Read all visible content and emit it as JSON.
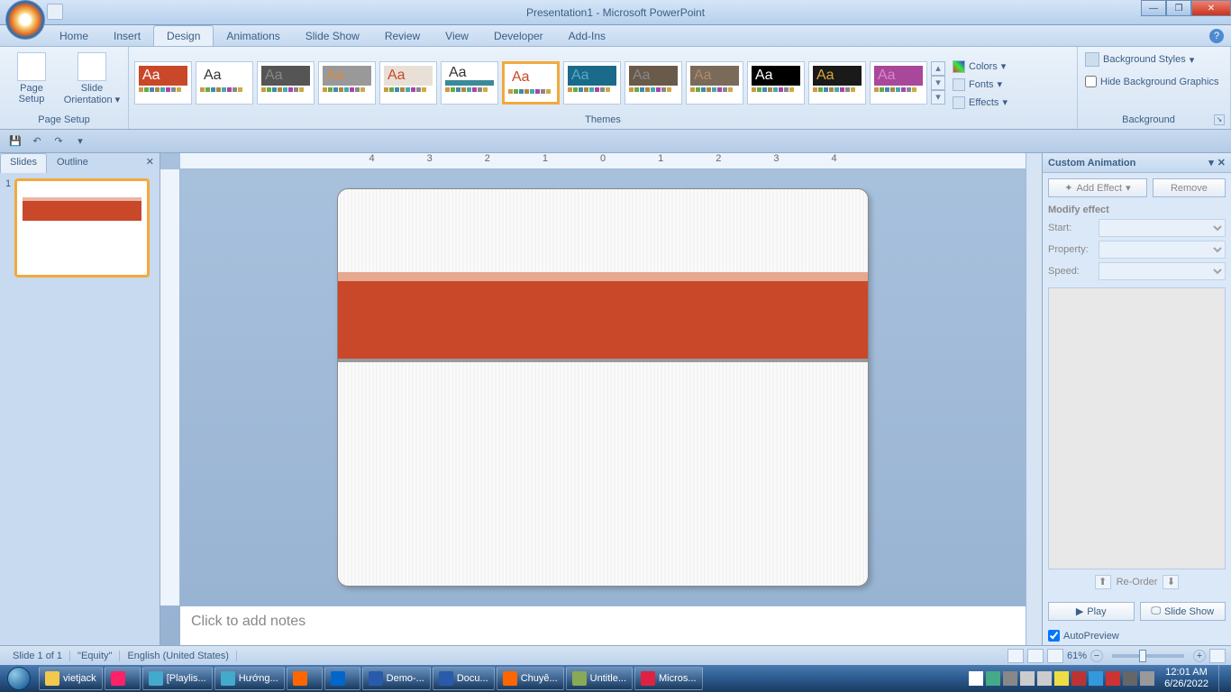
{
  "title": "Presentation1 - Microsoft PowerPoint",
  "tabs": [
    "Home",
    "Insert",
    "Design",
    "Animations",
    "Slide Show",
    "Review",
    "View",
    "Developer",
    "Add-Ins"
  ],
  "active_tab": "Design",
  "ribbon": {
    "page_setup": {
      "label": "Page Setup",
      "page_setup_btn": "Page\nSetup",
      "orientation_btn": "Slide\nOrientation"
    },
    "themes": {
      "label": "Themes",
      "colors": "Colors",
      "fonts": "Fonts",
      "effects": "Effects"
    },
    "background": {
      "label": "Background",
      "styles": "Background Styles",
      "hide": "Hide Background Graphics"
    }
  },
  "sidebar": {
    "tabs": [
      "Slides",
      "Outline"
    ],
    "active": "Slides",
    "slide_num": "1"
  },
  "notes_placeholder": "Click to add notes",
  "pane": {
    "title": "Custom Animation",
    "add": "Add Effect",
    "remove": "Remove",
    "modify": "Modify effect",
    "start": "Start:",
    "property": "Property:",
    "speed": "Speed:",
    "reorder": "Re-Order",
    "play": "Play",
    "slideshow": "Slide Show",
    "autopreview": "AutoPreview"
  },
  "status": {
    "slide": "Slide 1 of 1",
    "theme": "\"Equity\"",
    "lang": "English (United States)",
    "zoom": "61%"
  },
  "taskbar": {
    "items": [
      "vietjack",
      "",
      "[Playlis...",
      "Hướng...",
      "",
      "",
      "Demo-...",
      "Docu...",
      "Chuyê...",
      "Untitle...",
      "Micros..."
    ],
    "time": "12:01 AM",
    "date": "6/26/2022"
  },
  "theme_colors": {
    "t1": {
      "aa": "#fff",
      "bg": "#c9482a"
    },
    "t2": {
      "aa": "#333",
      "bg": "#fff"
    },
    "t3": {
      "aa": "#888",
      "bg": "#555"
    },
    "t4": {
      "aa": "#d98a3c",
      "bg": "#999"
    },
    "t5": {
      "aa": "#c9482a",
      "bg": "#e8e0d6"
    },
    "t6": {
      "aa": "#333",
      "bg": "#fff",
      "bar": "#3a8a9a"
    },
    "t7": {
      "aa": "#c9482a",
      "bg": "#fff"
    },
    "t8": {
      "aa": "#5aa8c8",
      "bg": "#1a6a8a"
    },
    "t9": {
      "aa": "#888",
      "bg": "#6a5a4a"
    },
    "t10": {
      "aa": "#b08a6a",
      "bg": "#7a6a5a"
    },
    "t11": {
      "aa": "#fff",
      "bg": "#000"
    },
    "t12": {
      "aa": "#d9a83c",
      "bg": "#1a1a1a"
    },
    "t13": {
      "aa": "#d988c8",
      "bg": "#a8489a"
    }
  }
}
